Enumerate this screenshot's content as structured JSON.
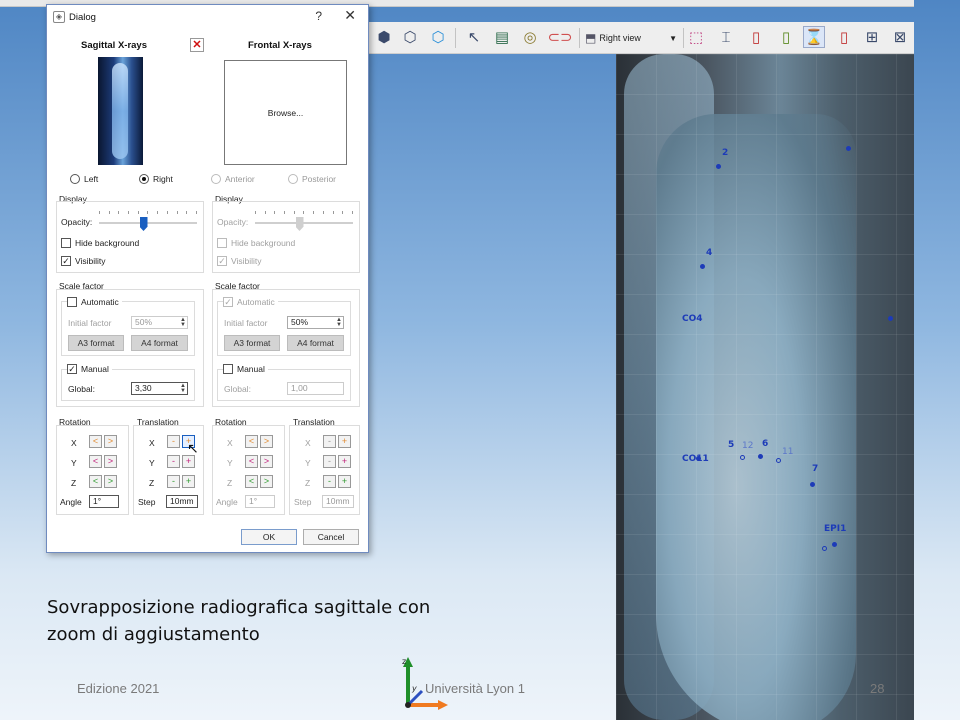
{
  "toolbar": {
    "view_label": "Right view"
  },
  "dialog": {
    "title": "Dialog",
    "help": "?",
    "close": "✕",
    "sagittal": {
      "header": "Sagittal X-rays",
      "remove": "✕",
      "side_left": "Left",
      "side_right": "Right",
      "side_selected": "Right",
      "display_title": "Display",
      "opacity_label": "Opacity:",
      "opacity_level": 0.45,
      "hide_bg_label": "Hide background",
      "hide_bg_checked": false,
      "visibility_label": "Visibility",
      "visibility_checked": true,
      "scale_title": "Scale factor",
      "automatic_label": "Automatic",
      "initial_factor_label": "Initial factor",
      "initial_factor_value": "50%",
      "a3_label": "A3 format",
      "a4_label": "A4 format",
      "manual_label": "Manual",
      "global_label": "Global:",
      "global_value": "3,30",
      "rotation_title": "Rotation",
      "translation_title": "Translation",
      "angle_label": "Angle",
      "angle_value": "1°",
      "step_label": "Step",
      "step_value": "10mm"
    },
    "frontal": {
      "header": "Frontal X-rays",
      "browse": "Browse...",
      "side_anterior": "Anterior",
      "side_posterior": "Posterior",
      "display_title": "Display",
      "opacity_label": "Opacity:",
      "opacity_level": 0.45,
      "hide_bg_label": "Hide background",
      "visibility_label": "Visibility",
      "scale_title": "Scale factor",
      "automatic_label": "Automatic",
      "initial_factor_label": "Initial factor",
      "initial_factor_value": "50%",
      "a3_label": "A3 format",
      "a4_label": "A4 format",
      "manual_label": "Manual",
      "global_label": "Global:",
      "global_value": "1,00",
      "rotation_title": "Rotation",
      "translation_title": "Translation",
      "angle_label": "Angle",
      "angle_value": "1°",
      "step_label": "Step",
      "step_value": "10mm"
    },
    "axes": {
      "x": "X",
      "y": "Y",
      "z": "Z"
    },
    "ok": "OK",
    "cancel": "Cancel"
  },
  "xray_labels": {
    "l1": "2",
    "l2": "4",
    "l3": "5",
    "l4": "6",
    "l5": "12",
    "l6": "11",
    "l7": "7",
    "l8": "EPI1",
    "l9": "CO4",
    "l10": "CO11"
  },
  "slide": {
    "caption_line1": "Sovrapposizione radiografica sagittale con",
    "caption_line2": "zoom di aggiustamento",
    "footer_left": "Edizione 2021",
    "footer_center": "Università Lyon 1",
    "page_number": "28"
  },
  "colors": {
    "accent": "#1a5fc0",
    "landmark": "#1d3bb8"
  }
}
